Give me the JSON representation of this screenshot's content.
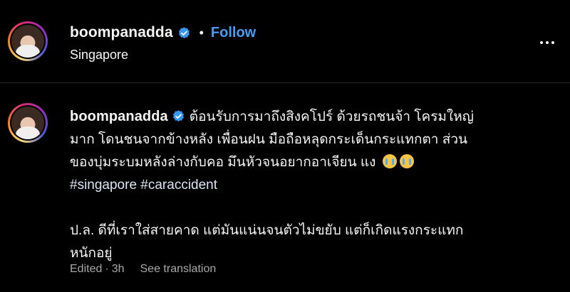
{
  "header": {
    "username": "boompanadda",
    "separator": "•",
    "follow_label": "Follow",
    "location": "Singapore"
  },
  "post": {
    "username": "boompanadda",
    "caption_line1": "ต้อนรับการมาถึงสิงคโปร์ ด้วยรถชนจ้า โครมใหญ่",
    "caption_line2": "มาก โดนชนจากข้างหลัง เพื่อนฝน มือถือหลุดกระเด็นกระแทกตา ส่วน",
    "caption_line3": "ของบุ่มระบมหลังล่างกับคอ มึนหัวจนอยากอาเจียน แง",
    "hashtags": "#singapore #caraccident",
    "caption_line5": "ป.ล. ดีที่เราใส่สายคาด แต่มันแน่นจนตัวไม่ขยับ แต่ก็เกิดแรงกระแทก",
    "caption_line6": "หนักอยู่",
    "edited_label": "Edited",
    "dot": "·",
    "time": "3h",
    "translate_label": "See translation"
  },
  "icons": {
    "verified": "verified-badge-icon",
    "more": "more-options-icon",
    "emoji": "crying-face-emoji"
  },
  "colors": {
    "background": "#000000",
    "follow": "#4a9bf5",
    "verified": "#3897f0",
    "muted": "#a8a8a8"
  }
}
